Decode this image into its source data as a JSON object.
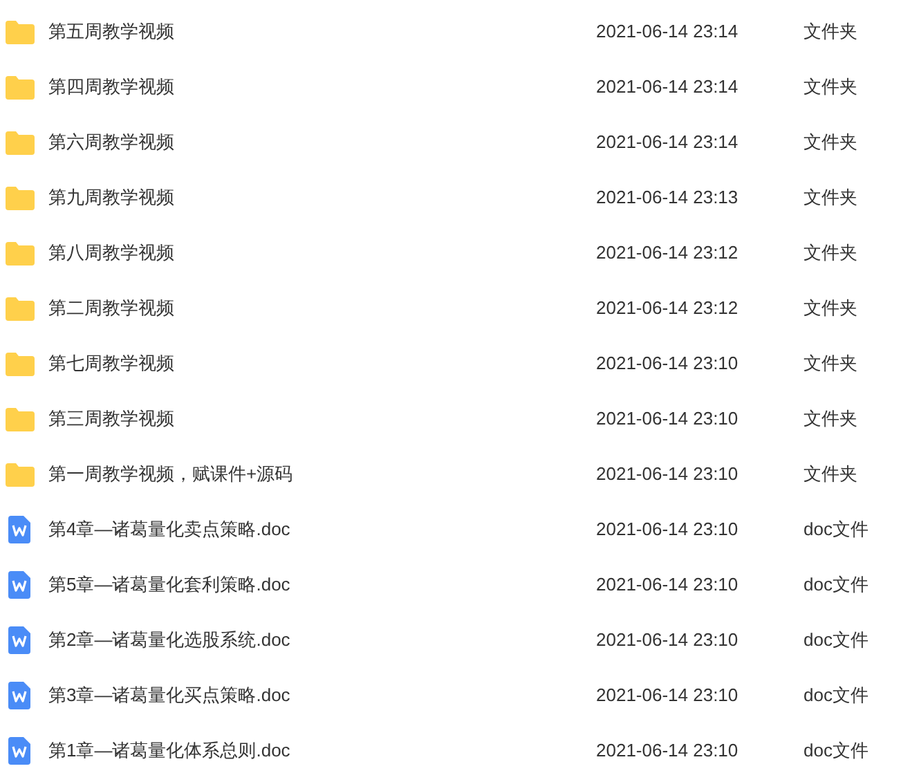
{
  "files": [
    {
      "kind": "folder",
      "name": "第五周教学视频",
      "modified": "2021-06-14 23:14",
      "type": "文件夹"
    },
    {
      "kind": "folder",
      "name": "第四周教学视频",
      "modified": "2021-06-14 23:14",
      "type": "文件夹"
    },
    {
      "kind": "folder",
      "name": "第六周教学视频",
      "modified": "2021-06-14 23:14",
      "type": "文件夹"
    },
    {
      "kind": "folder",
      "name": "第九周教学视频",
      "modified": "2021-06-14 23:13",
      "type": "文件夹"
    },
    {
      "kind": "folder",
      "name": "第八周教学视频",
      "modified": "2021-06-14 23:12",
      "type": "文件夹"
    },
    {
      "kind": "folder",
      "name": "第二周教学视频",
      "modified": "2021-06-14 23:12",
      "type": "文件夹"
    },
    {
      "kind": "folder",
      "name": "第七周教学视频",
      "modified": "2021-06-14 23:10",
      "type": "文件夹"
    },
    {
      "kind": "folder",
      "name": "第三周教学视频",
      "modified": "2021-06-14 23:10",
      "type": "文件夹"
    },
    {
      "kind": "folder",
      "name": "第一周教学视频，赋课件+源码",
      "modified": "2021-06-14 23:10",
      "type": "文件夹"
    },
    {
      "kind": "doc",
      "name": "第4章—诸葛量化卖点策略.doc",
      "modified": "2021-06-14 23:10",
      "type": "doc文件"
    },
    {
      "kind": "doc",
      "name": "第5章—诸葛量化套利策略.doc",
      "modified": "2021-06-14 23:10",
      "type": "doc文件"
    },
    {
      "kind": "doc",
      "name": "第2章—诸葛量化选股系统.doc",
      "modified": "2021-06-14 23:10",
      "type": "doc文件"
    },
    {
      "kind": "doc",
      "name": "第3章—诸葛量化买点策略.doc",
      "modified": "2021-06-14 23:10",
      "type": "doc文件"
    },
    {
      "kind": "doc",
      "name": "第1章—诸葛量化体系总则.doc",
      "modified": "2021-06-14 23:10",
      "type": "doc文件"
    }
  ]
}
